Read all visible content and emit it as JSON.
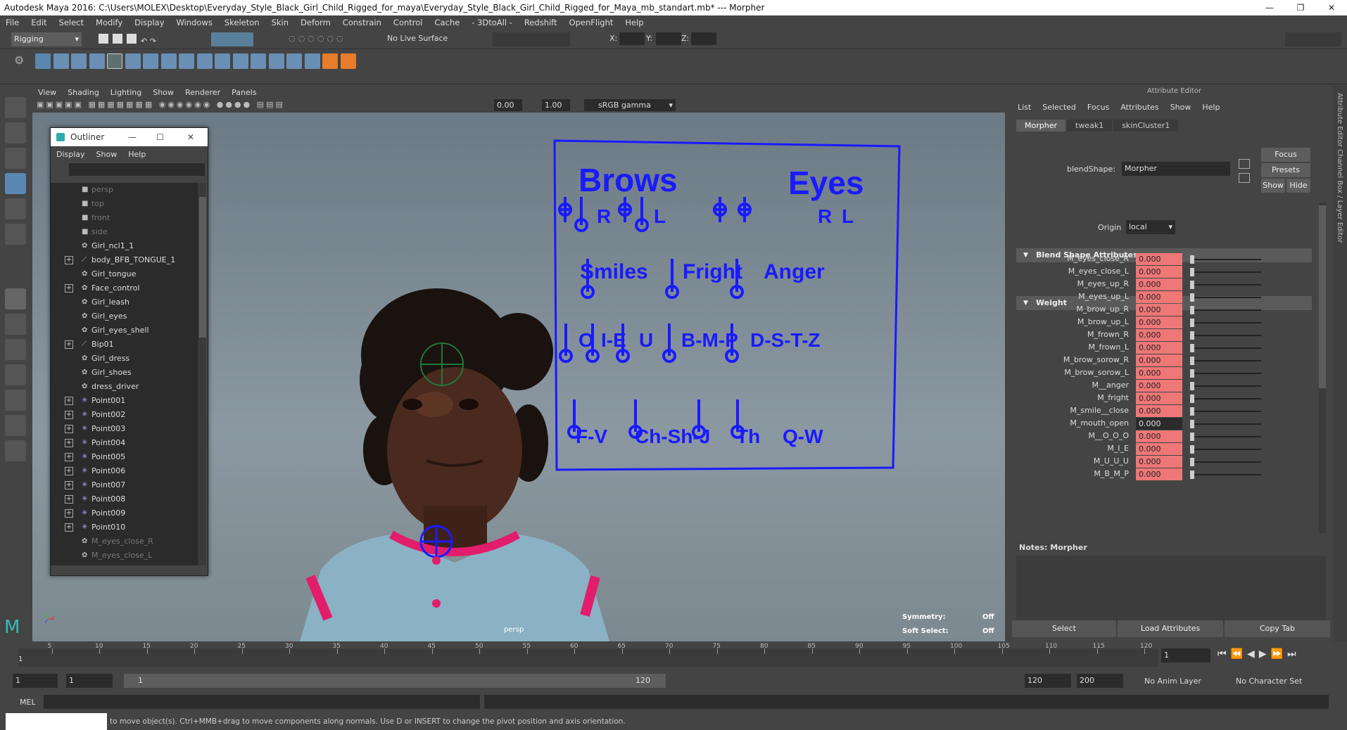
{
  "window": {
    "title": "Autodesk Maya 2016: C:\\Users\\MOLEX\\Desktop\\Everyday_Style_Black_Girl_Child_Rigged_for_maya\\Everyday_Style_Black_Girl_Child_Rigged_for_Maya_mb_standart.mb*   ---   Morpher"
  },
  "menubar": [
    "File",
    "Edit",
    "Select",
    "Modify",
    "Display",
    "Windows",
    "Skeleton",
    "Skin",
    "Deform",
    "Constrain",
    "Control",
    "Cache",
    "- 3DtoAll -",
    "Redshift",
    "OpenFlight",
    "Help"
  ],
  "status": {
    "mode": "Rigging",
    "live_surface": "No Live Surface",
    "x_label": "X:",
    "y_label": "Y:",
    "z_label": "Z:"
  },
  "panel_menu": [
    "View",
    "Shading",
    "Lighting",
    "Show",
    "Renderer",
    "Panels"
  ],
  "panel_tools": {
    "near": "0.00",
    "far": "1.00",
    "color_space": "sRGB gamma"
  },
  "outliner": {
    "title": "Outliner",
    "menu": [
      "Display",
      "Show",
      "Help"
    ],
    "items": [
      {
        "label": "persp",
        "icon": "camera-icon",
        "expand": false,
        "dim": true
      },
      {
        "label": "top",
        "icon": "camera-icon",
        "expand": false,
        "dim": true
      },
      {
        "label": "front",
        "icon": "camera-icon",
        "expand": false,
        "dim": true
      },
      {
        "label": "side",
        "icon": "camera-icon",
        "expand": false,
        "dim": true
      },
      {
        "label": "Girl_ncl1_1",
        "icon": "mesh-icon",
        "expand": false,
        "dim": false
      },
      {
        "label": "body_BFB_TONGUE_1",
        "icon": "joint-icon",
        "expand": true,
        "dim": false
      },
      {
        "label": "Girl_tongue",
        "icon": "mesh-icon",
        "expand": false,
        "dim": false
      },
      {
        "label": "Face_control",
        "icon": "mesh-icon",
        "expand": true,
        "dim": false
      },
      {
        "label": "Girl_leash",
        "icon": "mesh-icon",
        "expand": false,
        "dim": false
      },
      {
        "label": "Girl_eyes",
        "icon": "mesh-icon",
        "expand": false,
        "dim": false
      },
      {
        "label": "Girl_eyes_shell",
        "icon": "mesh-icon",
        "expand": false,
        "dim": false
      },
      {
        "label": "Bip01",
        "icon": "joint-icon",
        "expand": true,
        "dim": false
      },
      {
        "label": "Girl_dress",
        "icon": "mesh-icon",
        "expand": false,
        "dim": false
      },
      {
        "label": "Girl_shoes",
        "icon": "mesh-icon",
        "expand": false,
        "dim": false
      },
      {
        "label": "dress_driver",
        "icon": "mesh-icon",
        "expand": false,
        "dim": false
      },
      {
        "label": "Point001",
        "icon": "locator-icon",
        "expand": true,
        "dim": false
      },
      {
        "label": "Point002",
        "icon": "locator-icon",
        "expand": true,
        "dim": false
      },
      {
        "label": "Point003",
        "icon": "locator-icon",
        "expand": true,
        "dim": false
      },
      {
        "label": "Point004",
        "icon": "locator-icon",
        "expand": true,
        "dim": false
      },
      {
        "label": "Point005",
        "icon": "locator-icon",
        "expand": true,
        "dim": false
      },
      {
        "label": "Point006",
        "icon": "locator-icon",
        "expand": true,
        "dim": false
      },
      {
        "label": "Point007",
        "icon": "locator-icon",
        "expand": true,
        "dim": false
      },
      {
        "label": "Point008",
        "icon": "locator-icon",
        "expand": true,
        "dim": false
      },
      {
        "label": "Point009",
        "icon": "locator-icon",
        "expand": true,
        "dim": false
      },
      {
        "label": "Point010",
        "icon": "locator-icon",
        "expand": true,
        "dim": false
      },
      {
        "label": "M_eyes_close_R",
        "icon": "mesh-icon",
        "expand": false,
        "dim": true
      },
      {
        "label": "M_eyes_close_L",
        "icon": "mesh-icon",
        "expand": false,
        "dim": true
      }
    ]
  },
  "face_board": {
    "brows": "Brows",
    "eyes": "Eyes",
    "r": "R",
    "l": "L",
    "smiles": "Smiles",
    "fright": "Fright",
    "anger": "Anger",
    "o": "O",
    "ie": "I-E",
    "u": "U",
    "bmp": "B-M-P",
    "dstz": "D-S-T-Z",
    "fv": "F-V",
    "chshj": "Ch-Sh-J",
    "th": "Th",
    "qw": "Q-W"
  },
  "viewport": {
    "camera": "persp",
    "symmetry_label": "Symmetry:",
    "symmetry_value": "Off",
    "soft_select_label": "Soft Select:",
    "soft_select_value": "Off"
  },
  "attr": {
    "title": "Attribute Editor",
    "menu": [
      "List",
      "Selected",
      "Focus",
      "Attributes",
      "Show",
      "Help"
    ],
    "tabs": [
      "Morpher",
      "tweak1",
      "skinCluster1"
    ],
    "blend_label": "blendShape:",
    "blend_value": "Morpher",
    "focus": "Focus",
    "presets": "Presets",
    "show": "Show",
    "hide": "Hide",
    "section1": "Blend Shape Attributes",
    "origin_label": "Origin",
    "origin_value": "local",
    "section2": "Weight",
    "weights": [
      {
        "name": "M_eyes_close_R",
        "value": "0.000",
        "keyed": true
      },
      {
        "name": "M_eyes_close_L",
        "value": "0.000",
        "keyed": true
      },
      {
        "name": "M_eyes_up_R",
        "value": "0.000",
        "keyed": true
      },
      {
        "name": "M_eyes_up_L",
        "value": "0.000",
        "keyed": true
      },
      {
        "name": "M_brow_up_R",
        "value": "0.000",
        "keyed": true
      },
      {
        "name": "M_brow_up_L",
        "value": "0.000",
        "keyed": true
      },
      {
        "name": "M_frown_R",
        "value": "0.000",
        "keyed": true
      },
      {
        "name": "M_frown_L",
        "value": "0.000",
        "keyed": true
      },
      {
        "name": "M_brow_sorow_R",
        "value": "0.000",
        "keyed": true
      },
      {
        "name": "M_brow_sorow_L",
        "value": "0.000",
        "keyed": true
      },
      {
        "name": "M__anger",
        "value": "0.000",
        "keyed": true
      },
      {
        "name": "M_fright",
        "value": "0.000",
        "keyed": true
      },
      {
        "name": "M_smile__close",
        "value": "0.000",
        "keyed": true
      },
      {
        "name": "M_mouth_open",
        "value": "0.000",
        "keyed": false
      },
      {
        "name": "M__O_O_O",
        "value": "0.000",
        "keyed": true
      },
      {
        "name": "M_I_E",
        "value": "0.000",
        "keyed": true
      },
      {
        "name": "M_U_U_U",
        "value": "0.000",
        "keyed": true
      },
      {
        "name": "M_B_M_P",
        "value": "0.000",
        "keyed": true
      }
    ],
    "notes_label": "Notes:  Morpher",
    "btn_select": "Select",
    "btn_load": "Load Attributes",
    "btn_copy": "Copy Tab",
    "side_tabs": "Attribute Editor   Channel Box / Layer Editor"
  },
  "timeline": {
    "ticks": [
      "5",
      "10",
      "15",
      "20",
      "25",
      "30",
      "35",
      "40",
      "45",
      "50",
      "55",
      "60",
      "65",
      "70",
      "75",
      "80",
      "85",
      "90",
      "95",
      "100",
      "105",
      "110",
      "115",
      "120"
    ],
    "first": "1",
    "current": "1"
  },
  "range": {
    "start": "1",
    "start2": "1",
    "slider_start": "1",
    "slider_end": "120",
    "end": "120",
    "end2": "200",
    "anim_layer": "No Anim Layer",
    "char_set": "No Character Set"
  },
  "cmd": {
    "label": "MEL"
  },
  "help": {
    "text": "to move object(s). Ctrl+MMB+drag to move components along normals. Use D or INSERT to change the pivot position and axis orientation."
  }
}
